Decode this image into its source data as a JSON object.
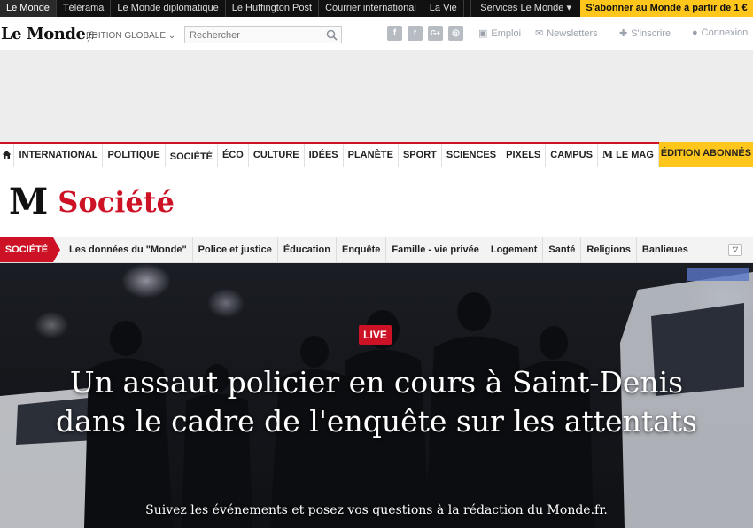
{
  "topbar": {
    "sites": [
      "Le Monde",
      "Télérama",
      "Le Monde diplomatique",
      "Le Huffington Post",
      "Courrier international",
      "La Vie"
    ],
    "services": "Services Le Monde ▾",
    "subscribe": "S'abonner au Monde à partir de 1 €"
  },
  "header": {
    "logo": "Le Monde",
    "logo_suffix": ".fr",
    "edition": "ÉDITION GLOBALE ⌄",
    "search_placeholder": "Rechercher",
    "social": [
      "f",
      "t",
      "G+",
      "◎"
    ],
    "links": {
      "emploi": "Emploi",
      "newsletters": "Newsletters",
      "inscrire": "S'inscrire",
      "connexion": "Connexion"
    }
  },
  "mainnav": {
    "items": [
      "INTERNATIONAL",
      "POLITIQUE",
      "SOCIÉTÉ",
      "ÉCO",
      "CULTURE",
      "IDÉES",
      "PLANÈTE",
      "SPORT",
      "SCIENCES",
      "PIXELS",
      "CAMPUS",
      "LE MAG"
    ],
    "mag_glyph": "M",
    "abonnes": "ÉDITION ABONNÉS"
  },
  "section": {
    "glyph": "M",
    "title": "Société"
  },
  "subnav": {
    "tag": "SOCIÉTÉ",
    "items": [
      "Les données du \"Monde\"",
      "Police et justice",
      "Éducation",
      "Enquête",
      "Famille - vie privée",
      "Logement",
      "Santé",
      "Religions",
      "Banlieues"
    ]
  },
  "hero": {
    "badge": "LIVE",
    "headline": "Un assaut policier en cours à Saint-Denis dans le cadre de l'enquête sur les attentats",
    "lede": "Suivez les événements et posez vos questions à la rédaction du Monde.fr."
  },
  "colors": {
    "brand_red": "#cc1224",
    "subscribe_yellow": "#ffc61b",
    "topbar_bg": "#111111"
  }
}
